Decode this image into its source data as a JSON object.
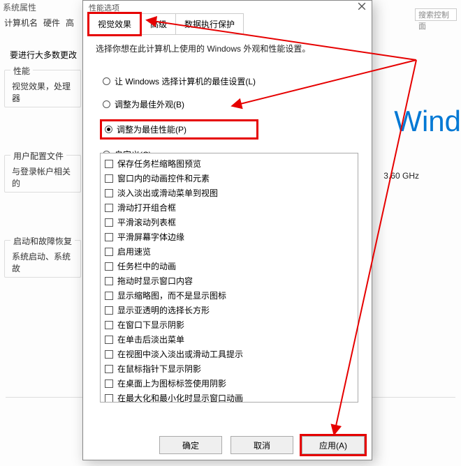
{
  "background": {
    "title": "系统属性",
    "tabs": {
      "t1": "计算机名",
      "t2": "硬件",
      "t3": "高"
    },
    "msg1": "要进行大多数更改",
    "group_perf": {
      "heading": "性能",
      "body": "视觉效果，处理器"
    },
    "group_user": {
      "heading": "用户配置文件",
      "body": "与登录帐户相关的"
    },
    "group_startup": {
      "heading": "启动和故障恢复",
      "body": "系统启动、系统故"
    },
    "search_placeholder": "搜索控制面",
    "wind_text": "Wind",
    "ghz": "3.60 GHz"
  },
  "dialog": {
    "title": "性能选项",
    "tabs": {
      "visual": "视觉效果",
      "advanced": "高级",
      "dep": "数据执行保护"
    },
    "description": "选择你想在此计算机上使用的 Windows 外观和性能设置。",
    "radios": {
      "r1": "让 Windows 选择计算机的最佳设置(L)",
      "r2": "调整为最佳外观(B)",
      "r3": "调整为最佳性能(P)",
      "r4": "自定义(C):"
    },
    "checkboxes": [
      "保存任务栏缩略图预览",
      "窗口内的动画控件和元素",
      "淡入淡出或滑动菜单到视图",
      "滑动打开组合框",
      "平滑滚动列表框",
      "平滑屏幕字体边缘",
      "启用速览",
      "任务栏中的动画",
      "拖动时显示窗口内容",
      "显示缩略图，而不是显示图标",
      "显示亚透明的选择长方形",
      "在窗口下显示阴影",
      "在单击后淡出菜单",
      "在视图中淡入淡出或滑动工具提示",
      "在鼠标指针下显示阴影",
      "在桌面上为图标标签使用阴影",
      "在最大化和最小化时显示窗口动画"
    ],
    "buttons": {
      "ok": "确定",
      "cancel": "取消",
      "apply": "应用(A)"
    }
  },
  "annotations": {
    "arrow_color": "#e60000"
  }
}
